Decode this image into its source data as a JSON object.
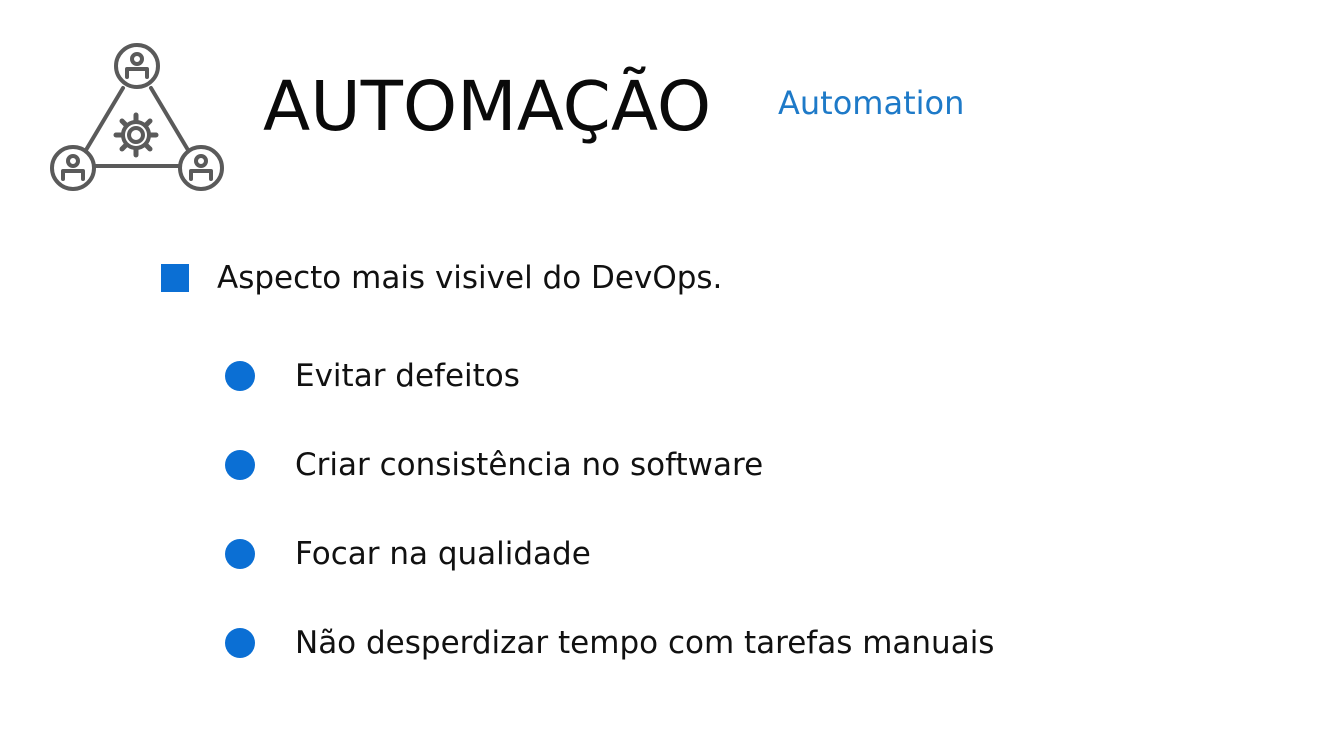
{
  "header": {
    "title": "AUTOMAÇÃO",
    "subtitle": "Automation",
    "icon": "team-automation-gear-icon"
  },
  "content": {
    "main_point": "Aspecto mais visivel do DevOps.",
    "sub_points": [
      "Evitar defeitos",
      "Criar consistência no software",
      "Focar na qualidade",
      "Não desperdizar tempo com tarefas manuais"
    ]
  },
  "colors": {
    "accent": "#0b6fd4",
    "subtitle": "#1e7ac8",
    "icon_gray": "#555555",
    "text": "#111111"
  }
}
